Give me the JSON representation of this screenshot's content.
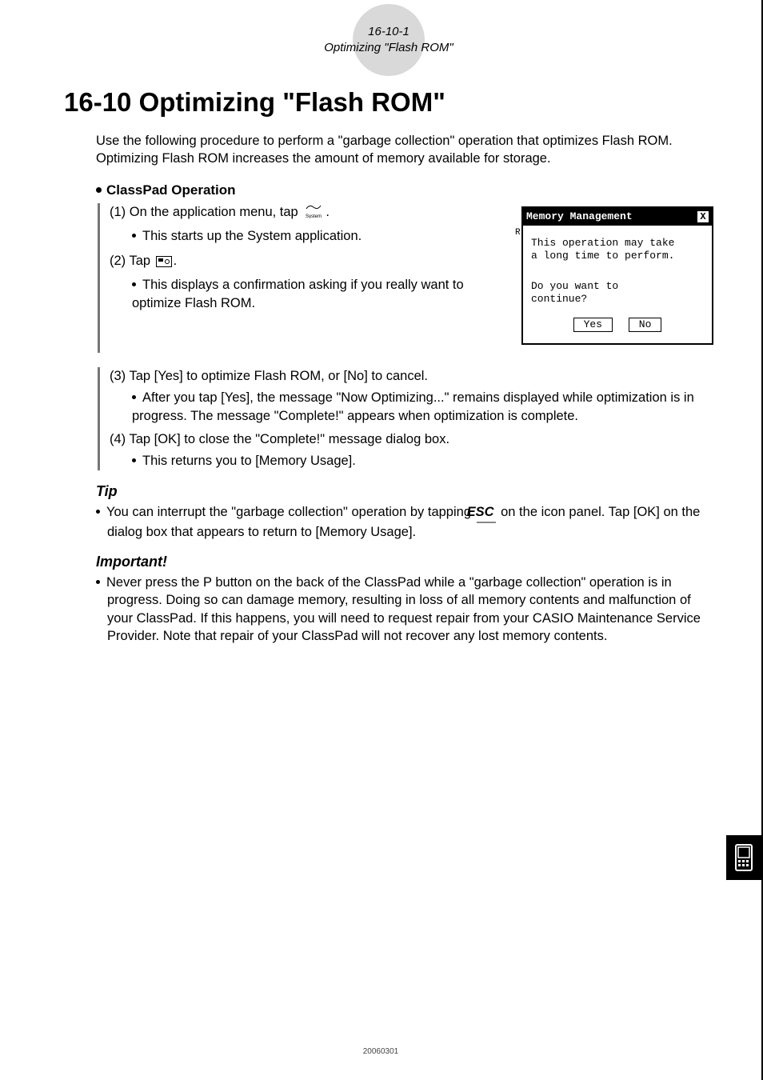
{
  "header": {
    "page_ref": "16-10-1",
    "page_subtitle": "Optimizing \"Flash ROM\""
  },
  "title": "16-10  Optimizing \"Flash ROM\"",
  "intro": "Use the following procedure to perform a \"garbage collection\" operation that optimizes Flash ROM. Optimizing Flash ROM increases the amount of memory available for storage.",
  "operation_heading": "ClassPad Operation",
  "steps": {
    "s1": "(1) On the application menu, tap ",
    "s1_after": ".",
    "s1_sub": "This starts up the System application.",
    "s2": "(2) Tap ",
    "s2_after": ".",
    "s2_sub": "This displays a confirmation asking if you really want to optimize Flash ROM.",
    "s3": "(3) Tap [Yes] to optimize Flash ROM, or [No] to cancel.",
    "s3_sub": "After you tap [Yes], the message \"Now Optimizing...\" remains displayed while optimization is in progress. The message \"Complete!\" appears when optimization is complete.",
    "s4": "(4) Tap [OK] to close the \"Complete!\" message dialog box.",
    "s4_sub": "This returns you to [Memory Usage]."
  },
  "dialog": {
    "title": "Memory Management",
    "line1": "This operation may take",
    "line2": "a long time to perform.",
    "question1": "Do you want to",
    "question2": "continue?",
    "yes": "Yes",
    "no": "No"
  },
  "tip": {
    "heading": "Tip",
    "body_a": "You can interrupt the \"garbage collection\" operation by tapping ",
    "esc": "ESC",
    "body_b": " on the icon panel. Tap [OK] on the dialog box that appears to return to [Memory Usage]."
  },
  "important": {
    "heading": "Important!",
    "body": "Never press the P button on the back of the ClassPad while a \"garbage collection\" operation is in progress. Doing so can damage memory, resulting in loss of all memory contents and malfunction of your ClassPad. If this happens, you will need to request repair from your CASIO Maintenance Service Provider. Note that repair of your ClassPad will not recover any lost memory contents."
  },
  "footer": "20060301",
  "icons": {
    "system_label": "System"
  }
}
